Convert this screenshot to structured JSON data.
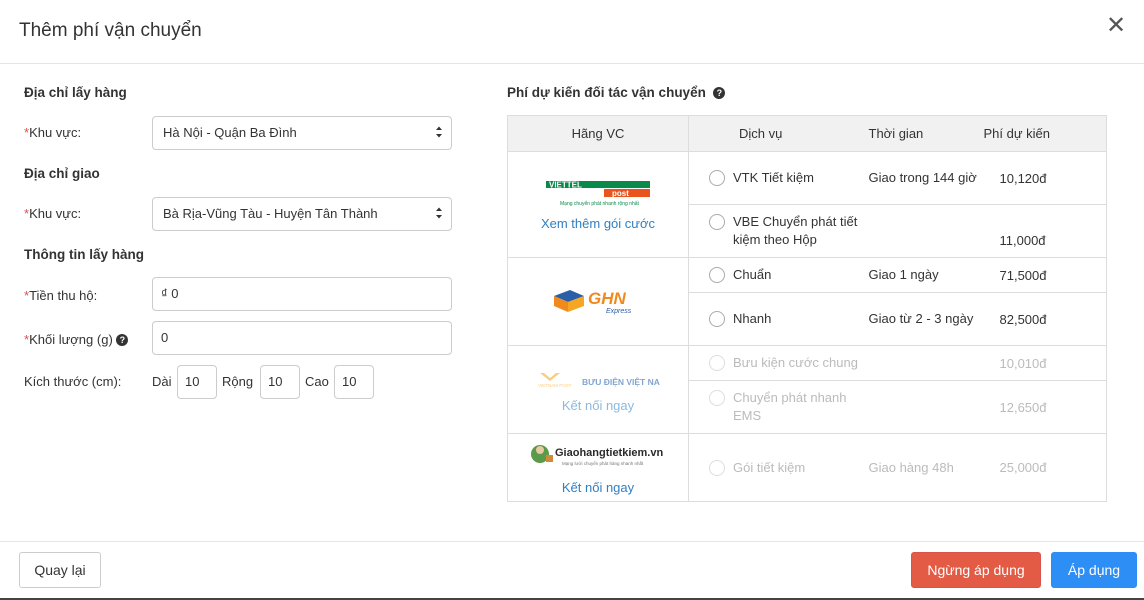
{
  "modal": {
    "title": "Thêm phí vận chuyển"
  },
  "form": {
    "pickup_heading": "Địa chỉ lấy hàng",
    "region_label": "Khu vực:",
    "pickup_region": "Hà Nội - Quận Ba Đình",
    "delivery_heading": "Địa chỉ giao",
    "delivery_region": "Bà Rịa-Vũng Tàu - Huyện Tân Thành",
    "info_heading": "Thông tin lấy hàng",
    "cod_label": "Tiền thu hộ:",
    "cod_value": "₫ 0",
    "weight_label": "Khối lượng (g)",
    "weight_value": "0",
    "size_label": "Kích thước (cm):",
    "length_label": "Dài",
    "length_value": "10",
    "width_label": "Rộng",
    "width_value": "10",
    "height_label": "Cao",
    "height_value": "10"
  },
  "estimate": {
    "heading": "Phí dự kiến đối tác vận chuyển",
    "columns": [
      "Hãng VC",
      "Dịch vụ",
      "Thời gian",
      "Phí dự kiến"
    ],
    "carriers": [
      {
        "logo": "ViettelPost",
        "logo_tag": "Mạng chuyển phát nhanh rộng nhất",
        "link": "Xem thêm gói cước",
        "services": [
          {
            "name": "VTK Tiết kiệm",
            "time": "Giao trong 144 giờ",
            "fee": "10,120đ"
          },
          {
            "name": "VBE Chuyển phát tiết kiệm theo Hộp",
            "time": "",
            "fee": "11,000đ"
          }
        ]
      },
      {
        "logo": "GHN",
        "logo_sub": "Express",
        "link": "",
        "services": [
          {
            "name": "Chuẩn",
            "time": "Giao 1 ngày",
            "fee": "71,500đ"
          },
          {
            "name": "Nhanh",
            "time": "Giao từ 2 - 3 ngày",
            "fee": "82,500đ"
          }
        ]
      },
      {
        "logo": "BƯU ĐIỆN VIỆT NAM",
        "logo_sub": "VIETNAM POST",
        "link": "Kết nối ngay",
        "services": [
          {
            "name": "Bưu kiện cước chung",
            "time": "",
            "fee": "10,010đ"
          },
          {
            "name": "Chuyển phát nhanh EMS",
            "time": "",
            "fee": "12,650đ"
          }
        ]
      },
      {
        "logo": "Giaohangtietkiem.vn",
        "logo_tag": "Mạng lưới chuyển phát hàng nhanh nhất",
        "link": "Kết nối ngay",
        "services": [
          {
            "name": "Gói tiết kiệm",
            "time": "Giao hàng 48h",
            "fee": "25,000đ"
          }
        ]
      }
    ]
  },
  "footer": {
    "back_label": "Quay lại",
    "stop_label": "Ngừng áp dụng",
    "apply_label": "Áp dụng"
  },
  "colors": {
    "primary": "#2d8ef5",
    "danger": "#e35b44",
    "link": "#2f7fc4"
  },
  "icons": {
    "close": "close-icon",
    "help": "question-circle-icon",
    "select": "select-arrows-icon"
  }
}
